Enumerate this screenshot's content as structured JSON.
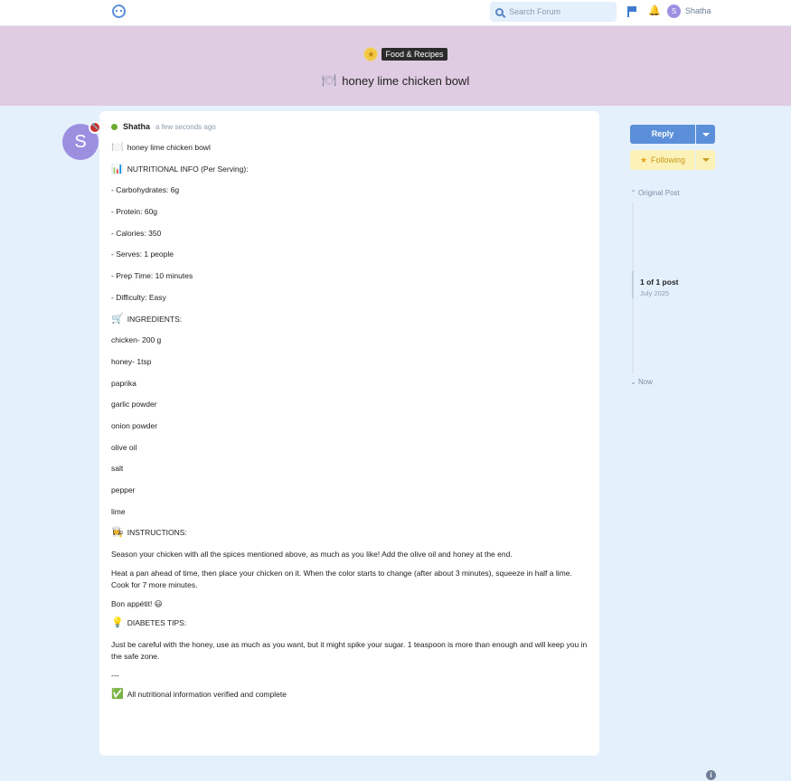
{
  "header": {
    "search_placeholder": "Search Forum",
    "username": "Shatha",
    "avatar_letter": "S"
  },
  "banner": {
    "category": "Food & Recipes",
    "title": "honey lime chicken bowl"
  },
  "post": {
    "avatar_letter": "S",
    "author": "Shatha",
    "timestamp": "a few seconds ago",
    "lines": [
      {
        "emoji": "🍽️",
        "text": "honey lime chicken bowl"
      },
      {
        "emoji": "📊",
        "text": "NUTRITIONAL INFO (Per Serving):"
      },
      {
        "emoji": "",
        "text": "- Carbohydrates: 6g"
      },
      {
        "emoji": "",
        "text": "- Protein: 60g"
      },
      {
        "emoji": "",
        "text": "- Calories: 350"
      },
      {
        "emoji": "",
        "text": "- Serves: 1 people"
      },
      {
        "emoji": "",
        "text": "- Prep Time: 10 minutes"
      },
      {
        "emoji": "",
        "text": "- Difficulty: Easy"
      },
      {
        "emoji": "🛒",
        "text": "INGREDIENTS:"
      },
      {
        "emoji": "",
        "text": "chicken- 200 g"
      },
      {
        "emoji": "",
        "text": "honey- 1tsp"
      },
      {
        "emoji": "",
        "text": "paprika"
      },
      {
        "emoji": "",
        "text": "garlic powder"
      },
      {
        "emoji": "",
        "text": "onion powder"
      },
      {
        "emoji": "",
        "text": "olive oil"
      },
      {
        "emoji": "",
        "text": "salt"
      },
      {
        "emoji": "",
        "text": "pepper"
      },
      {
        "emoji": "",
        "text": "lime"
      },
      {
        "emoji": "👩‍🍳",
        "text": "INSTRUCTIONS:"
      }
    ],
    "paragraphs": [
      "Season your chicken with all the spices mentioned above, as much as you like! Add the olive oil and honey at the end.",
      "Heat a pan ahead of time, then place your chicken on it. When the color starts to change (after about 3 minutes), squeeze in half a lime. Cook for 7 more minutes.",
      "Bon appétit! 😃"
    ],
    "tips_heading": {
      "emoji": "💡",
      "text": "DIABETES TIPS:"
    },
    "tips_text": "Just be careful with the honey, use as much as you want, but it might spike your sugar. 1 teaspoon is more than enough and will keep you in the safe zone.",
    "separator": "---",
    "footer": {
      "emoji": "✅",
      "text": "All nutritional information verified and complete"
    }
  },
  "sidebar": {
    "reply_label": "Reply",
    "following_label": "Following",
    "original_post": "Original Post",
    "post_count": "1 of 1 post",
    "post_date": "July 2025",
    "now_label": "Now"
  },
  "colors": {
    "accent": "#5b8fd9",
    "banner": "#dfcbe2",
    "page_bg": "#e4f0fb",
    "following_bg": "#fcf2b8"
  }
}
